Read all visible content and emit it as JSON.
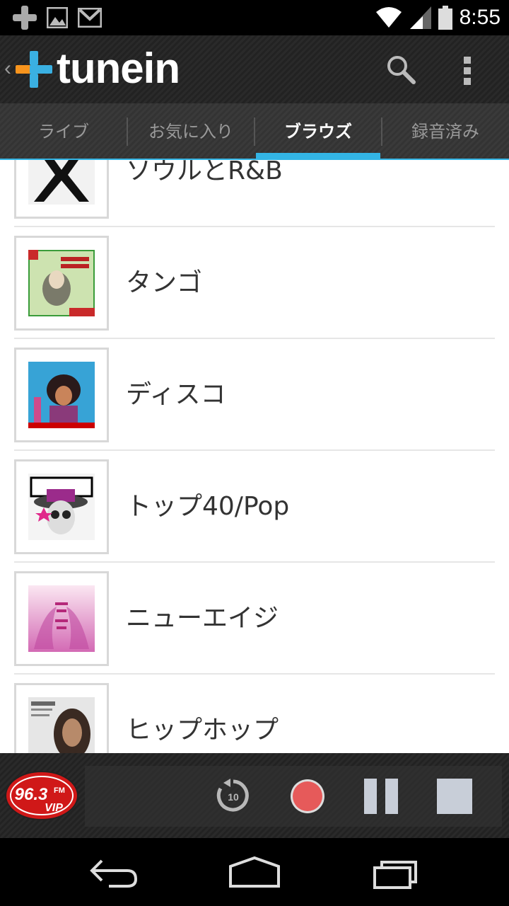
{
  "status_bar": {
    "time": "8:55",
    "icons": [
      "notification-icon",
      "image-icon",
      "gmail-icon",
      "wifi-icon",
      "signal-icon",
      "battery-icon"
    ]
  },
  "app_bar": {
    "back_glyph": "‹",
    "logo_text": "tunein",
    "accent": "#33b5e5"
  },
  "tabs": [
    {
      "label": "ライブ",
      "active": false
    },
    {
      "label": "お気に入り",
      "active": false
    },
    {
      "label": "ブラウズ",
      "active": true
    },
    {
      "label": "録音済み",
      "active": false
    }
  ],
  "genres": [
    {
      "label": "ソウルとR&B",
      "art": "vestrze-art"
    },
    {
      "label": "タンゴ",
      "art": "de-angelis-art"
    },
    {
      "label": "ディスコ",
      "art": "disco-diva-art"
    },
    {
      "label": "トップ40/Pop",
      "art": "wao-art"
    },
    {
      "label": "ニューエイジ",
      "art": "reiki-art"
    },
    {
      "label": "ヒップホップ",
      "art": "beyonce-art"
    }
  ],
  "player": {
    "station_name": "96.3",
    "station_suffix": "FM",
    "station_vip": "VIP",
    "rewind_label": "10"
  }
}
